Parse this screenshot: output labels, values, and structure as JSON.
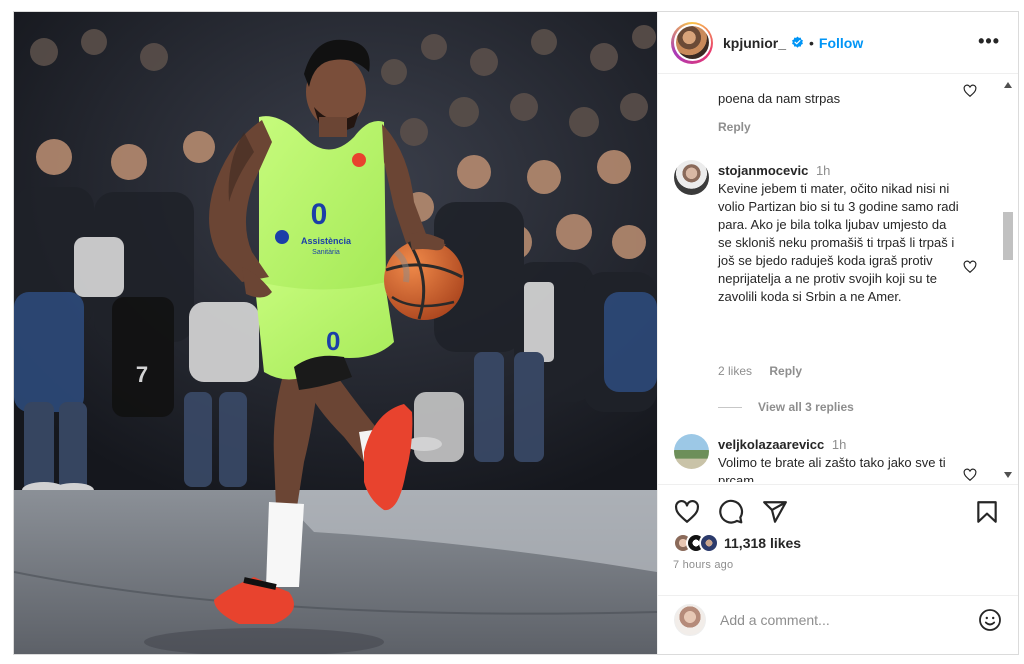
{
  "post": {
    "username": "kpjunior_",
    "separator": "•",
    "follow_label": "Follow",
    "more_label": "•••",
    "photo_alt": "Basketball player dribbling"
  },
  "photo": {
    "jersey_number": "0",
    "jersey_sponsor": "Assistència",
    "jersey_sponsor_sub": "Sanitària",
    "crowd_shirt_number": "7"
  },
  "comments": [
    {
      "text": "poena da nam strpas",
      "reply_label": "Reply"
    },
    {
      "username": "stojanmocevic",
      "time": "1h",
      "text": "Kevine jebem ti mater, očito nikad nisi ni volio Partizan bio si tu 3 godine samo radi para. Ako je bila tolka ljubav umjesto da se skloniš neku promašiš ti trpaš li trpaš i još se bjedo raduješ koda igraš protiv neprijatelja a ne protiv svojih koji su te zavolili koda si Srbin a ne Amer.",
      "likes_label": "2 likes",
      "reply_label": "Reply",
      "view_replies_label": "View all 3 replies"
    },
    {
      "username": "veljkolazaarevicc",
      "time": "1h",
      "text": "Volimo te brate ali zašto tako jako sve ti prcam"
    }
  ],
  "stats": {
    "likes_label": "11,318 likes",
    "time_ago": "7 hours ago"
  },
  "composer": {
    "placeholder": "Add a comment..."
  },
  "colors": {
    "accent": "#0095f6",
    "jersey": "#b8f56b",
    "shoes": "#e8432e",
    "ball": "#e06a2c"
  },
  "icons": [
    "verified-badge-icon",
    "more-options-icon",
    "heart-icon",
    "comment-icon",
    "share-icon",
    "bookmark-icon",
    "emoji-icon"
  ]
}
